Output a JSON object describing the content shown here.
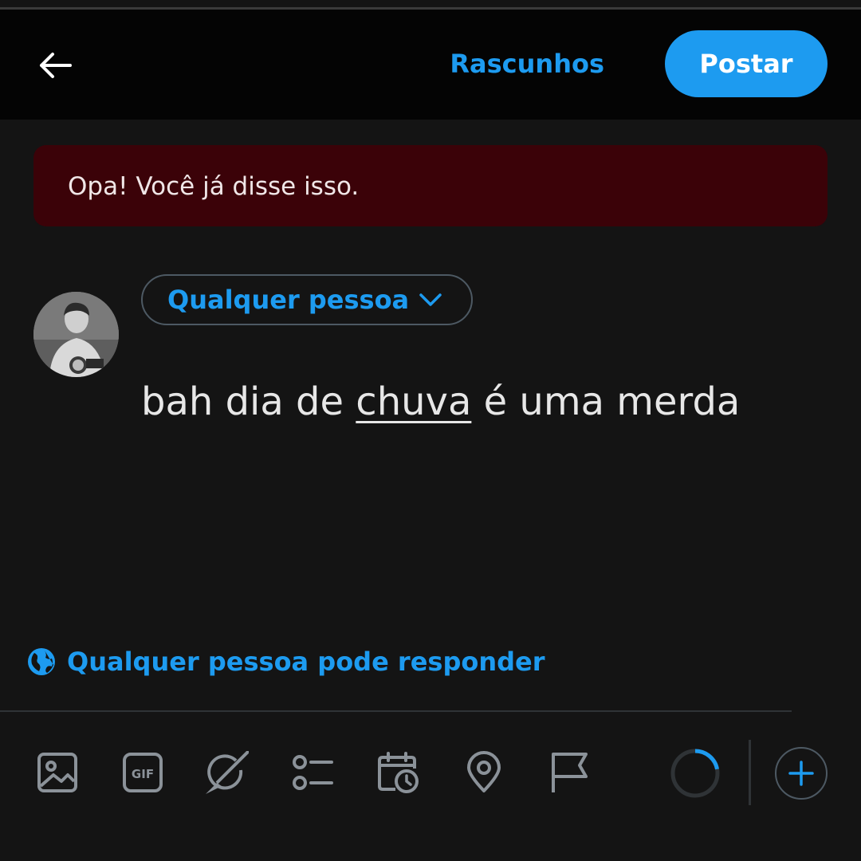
{
  "header": {
    "drafts_label": "Rascunhos",
    "post_label": "Postar"
  },
  "error": {
    "message": "Opa! Você já disse isso."
  },
  "composer": {
    "audience_label": "Qualquer pessoa",
    "text_parts": [
      "bah dia de ",
      "chuva",
      " é uma merda"
    ],
    "reply_setting": "Qualquer pessoa pode responder"
  },
  "toolbar": {
    "icons": [
      "image-icon",
      "gif-icon",
      "grok-icon",
      "poll-icon",
      "schedule-icon",
      "location-icon",
      "flag-icon"
    ],
    "gif_text": "GIF",
    "char_progress": 0.22
  },
  "colors": {
    "accent": "#1d9bf0",
    "error_bg": "#3b0208",
    "background": "#141414",
    "icon_gray": "#8b9299"
  }
}
